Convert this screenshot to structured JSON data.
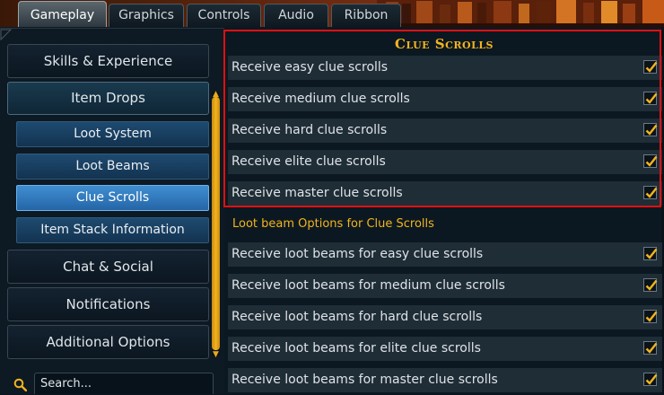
{
  "tabs": [
    {
      "label": "Gameplay",
      "active": true
    },
    {
      "label": "Graphics",
      "active": false
    },
    {
      "label": "Controls",
      "active": false
    },
    {
      "label": "Audio",
      "active": false
    },
    {
      "label": "Ribbon",
      "active": false
    }
  ],
  "sidebar": {
    "items": [
      {
        "label": "Skills & Experience"
      },
      {
        "label": "Item Drops",
        "expanded": true
      },
      {
        "label": "Chat & Social"
      },
      {
        "label": "Notifications"
      },
      {
        "label": "Additional Options"
      }
    ],
    "subitems": [
      {
        "label": "Loot System"
      },
      {
        "label": "Loot Beams"
      },
      {
        "label": "Clue Scrolls",
        "selected": true
      },
      {
        "label": "Item Stack Information"
      }
    ]
  },
  "search": {
    "placeholder": "Search..."
  },
  "main": {
    "section_title": "Clue Scrolls",
    "clue_options": [
      {
        "label": "Receive easy clue scrolls",
        "checked": true
      },
      {
        "label": "Receive medium clue scrolls",
        "checked": true
      },
      {
        "label": "Receive hard clue scrolls",
        "checked": true
      },
      {
        "label": "Receive elite clue scrolls",
        "checked": true
      },
      {
        "label": "Receive master clue scrolls",
        "checked": true
      }
    ],
    "loot_beam_heading": "Loot beam Options for Clue Scrolls",
    "loot_beam_options": [
      {
        "label": "Receive loot beams for easy clue scrolls",
        "checked": true
      },
      {
        "label": "Receive loot beams for medium clue scrolls",
        "checked": true
      },
      {
        "label": "Receive loot beams for hard clue scrolls",
        "checked": true
      },
      {
        "label": "Receive loot beams for elite clue scrolls",
        "checked": true
      },
      {
        "label": "Receive loot beams for master clue scrolls",
        "checked": true
      }
    ]
  },
  "colors": {
    "accent_gold": "#f2b41e",
    "highlight_red": "#e01010",
    "selected_blue": "#3f8ed0"
  }
}
